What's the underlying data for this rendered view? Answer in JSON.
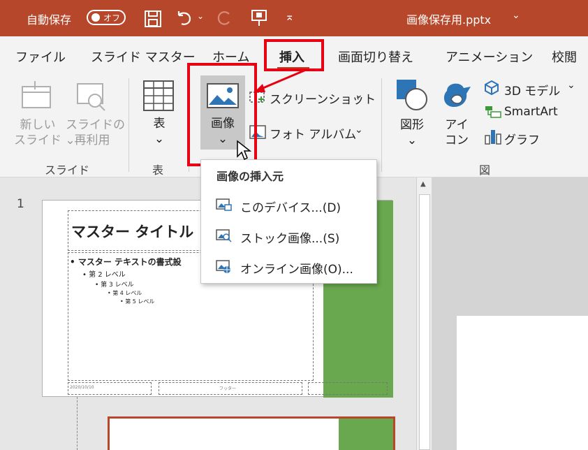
{
  "titlebar": {
    "autosave_label": "自動保存",
    "autosave_state": "オフ",
    "filename": "画像保存用.pptx",
    "filename_chevron": "⌄"
  },
  "tabs": {
    "file": "ファイル",
    "slide_master": "スライド マスター",
    "home": "ホーム",
    "insert": "挿入",
    "transitions": "画面切り替え",
    "animations": "アニメーション",
    "review": "校閲"
  },
  "ribbon": {
    "new_slide_line1": "新しい",
    "new_slide_line2": "スライド",
    "reuse_slide_line1": "スライドの",
    "reuse_slide_line2": "再利用",
    "slides_group": "スライド",
    "table": "表",
    "table_group": "表",
    "picture": "画像",
    "screenshot": "スクリーンショット",
    "photo_album": "フォト アルバム",
    "shapes": "図形",
    "icons_line1": "アイ",
    "icons_line2": "コン",
    "models_3d": "3D モデル",
    "smartart": "SmartArt",
    "chart": "グラフ",
    "illustrations_group": "図"
  },
  "dropdown": {
    "header": "画像の挿入元",
    "items": [
      "このデバイス...(D)",
      "ストック画像...(S)",
      "オンライン画像(O)..."
    ]
  },
  "slide_panel": {
    "slide_number": "1",
    "master_title": "マスター タイトル",
    "bullets": [
      "• マスター テキストの書式設",
      "• 第 2 レベル",
      "• 第 3 レベル",
      "• 第 4 レベル",
      "• 第 5 レベル"
    ],
    "footer_date": "2020/10/10",
    "footer_text": "フッター"
  },
  "colors": {
    "accent": "#b7472a",
    "highlight": "#e60012",
    "slide_green": "#6aa84f"
  }
}
